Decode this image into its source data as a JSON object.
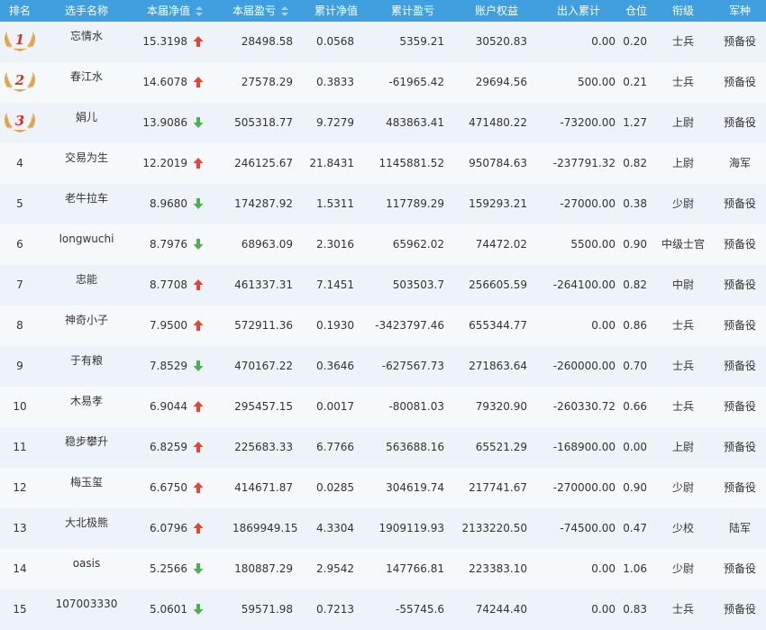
{
  "header": [
    "排名",
    "选手名称",
    "本届净值",
    "本届盈亏",
    "累计净值",
    "累计盈亏",
    "账户权益",
    "出入累计",
    "仓位",
    "衔级",
    "军种"
  ],
  "colors": {
    "header_bg": "#3f9fdf",
    "row_odd": "#eef3f9",
    "row_even": "#f6f9fc",
    "up": "#e8442f",
    "down": "#4caf50",
    "medal": "#e2a34a",
    "medal_num": "#d8301c"
  },
  "rows": [
    {
      "rank": "1",
      "name": "忘情水",
      "nav": "15.3198",
      "trend": "up",
      "pnl": "28498.58",
      "cum_nav": "0.0568",
      "cum_pnl": "5359.21",
      "equity": "30520.83",
      "flow": "0.00",
      "position": "0.20",
      "grade": "士兵",
      "branch": "预备役"
    },
    {
      "rank": "2",
      "name": "春江水",
      "nav": "14.6078",
      "trend": "up",
      "pnl": "27578.29",
      "cum_nav": "0.3833",
      "cum_pnl": "-61965.42",
      "equity": "29694.56",
      "flow": "500.00",
      "position": "0.21",
      "grade": "士兵",
      "branch": "预备役"
    },
    {
      "rank": "3",
      "name": "娟儿",
      "nav": "13.9086",
      "trend": "down",
      "pnl": "505318.77",
      "cum_nav": "9.7279",
      "cum_pnl": "483863.41",
      "equity": "471480.22",
      "flow": "-73200.00",
      "position": "1.27",
      "grade": "上尉",
      "branch": "预备役"
    },
    {
      "rank": "4",
      "name": "交易为生",
      "nav": "12.2019",
      "trend": "up",
      "pnl": "246125.67",
      "cum_nav": "21.8431",
      "cum_pnl": "1145881.52",
      "equity": "950784.63",
      "flow": "-237791.32",
      "position": "0.82",
      "grade": "上尉",
      "branch": "海军"
    },
    {
      "rank": "5",
      "name": "老牛拉车",
      "nav": "8.9680",
      "trend": "down",
      "pnl": "174287.92",
      "cum_nav": "1.5311",
      "cum_pnl": "117789.29",
      "equity": "159293.21",
      "flow": "-27000.00",
      "position": "0.38",
      "grade": "少尉",
      "branch": "预备役"
    },
    {
      "rank": "6",
      "name": "longwuchi",
      "nav": "8.7976",
      "trend": "down",
      "pnl": "68963.09",
      "cum_nav": "2.3016",
      "cum_pnl": "65962.02",
      "equity": "74472.02",
      "flow": "5500.00",
      "position": "0.90",
      "grade": "中级士官",
      "branch": "预备役"
    },
    {
      "rank": "7",
      "name": "忠能",
      "nav": "8.7708",
      "trend": "up",
      "pnl": "461337.31",
      "cum_nav": "7.1451",
      "cum_pnl": "503503.7",
      "equity": "256605.59",
      "flow": "-264100.00",
      "position": "0.82",
      "grade": "中尉",
      "branch": "预备役"
    },
    {
      "rank": "8",
      "name": "神奇小子",
      "nav": "7.9500",
      "trend": "up",
      "pnl": "572911.36",
      "cum_nav": "0.1930",
      "cum_pnl": "-3423797.46",
      "equity": "655344.77",
      "flow": "0.00",
      "position": "0.86",
      "grade": "士兵",
      "branch": "预备役"
    },
    {
      "rank": "9",
      "name": "于有粮",
      "nav": "7.8529",
      "trend": "down",
      "pnl": "470167.22",
      "cum_nav": "0.3646",
      "cum_pnl": "-627567.73",
      "equity": "271863.64",
      "flow": "-260000.00",
      "position": "0.70",
      "grade": "士兵",
      "branch": "预备役"
    },
    {
      "rank": "10",
      "name": "木易孝",
      "nav": "6.9044",
      "trend": "up",
      "pnl": "295457.15",
      "cum_nav": "0.0017",
      "cum_pnl": "-80081.03",
      "equity": "79320.90",
      "flow": "-260330.72",
      "position": "0.66",
      "grade": "士兵",
      "branch": "预备役"
    },
    {
      "rank": "11",
      "name": "稳步攀升",
      "nav": "6.8259",
      "trend": "up",
      "pnl": "225683.33",
      "cum_nav": "6.7766",
      "cum_pnl": "563688.16",
      "equity": "65521.29",
      "flow": "-168900.00",
      "position": "0.00",
      "grade": "上尉",
      "branch": "预备役"
    },
    {
      "rank": "12",
      "name": "梅玉玺",
      "nav": "6.6750",
      "trend": "up",
      "pnl": "414671.87",
      "cum_nav": "0.0285",
      "cum_pnl": "304619.74",
      "equity": "217741.67",
      "flow": "-270000.00",
      "position": "0.90",
      "grade": "少尉",
      "branch": "预备役"
    },
    {
      "rank": "13",
      "name": "大北极熊",
      "nav": "6.0796",
      "trend": "up",
      "pnl": "1869949.15",
      "cum_nav": "4.3304",
      "cum_pnl": "1909119.93",
      "equity": "2133220.50",
      "flow": "-74500.00",
      "position": "0.47",
      "grade": "少校",
      "branch": "陆军"
    },
    {
      "rank": "14",
      "name": "oasis",
      "nav": "5.2566",
      "trend": "down",
      "pnl": "180887.29",
      "cum_nav": "2.9542",
      "cum_pnl": "147766.81",
      "equity": "223383.10",
      "flow": "0.00",
      "position": "1.06",
      "grade": "少尉",
      "branch": "预备役"
    },
    {
      "rank": "15",
      "name": "107003330",
      "nav": "5.0601",
      "trend": "down",
      "pnl": "59571.98",
      "cum_nav": "0.7213",
      "cum_pnl": "-55745.6",
      "equity": "74244.40",
      "flow": "0.00",
      "position": "0.83",
      "grade": "士兵",
      "branch": "预备役"
    }
  ]
}
